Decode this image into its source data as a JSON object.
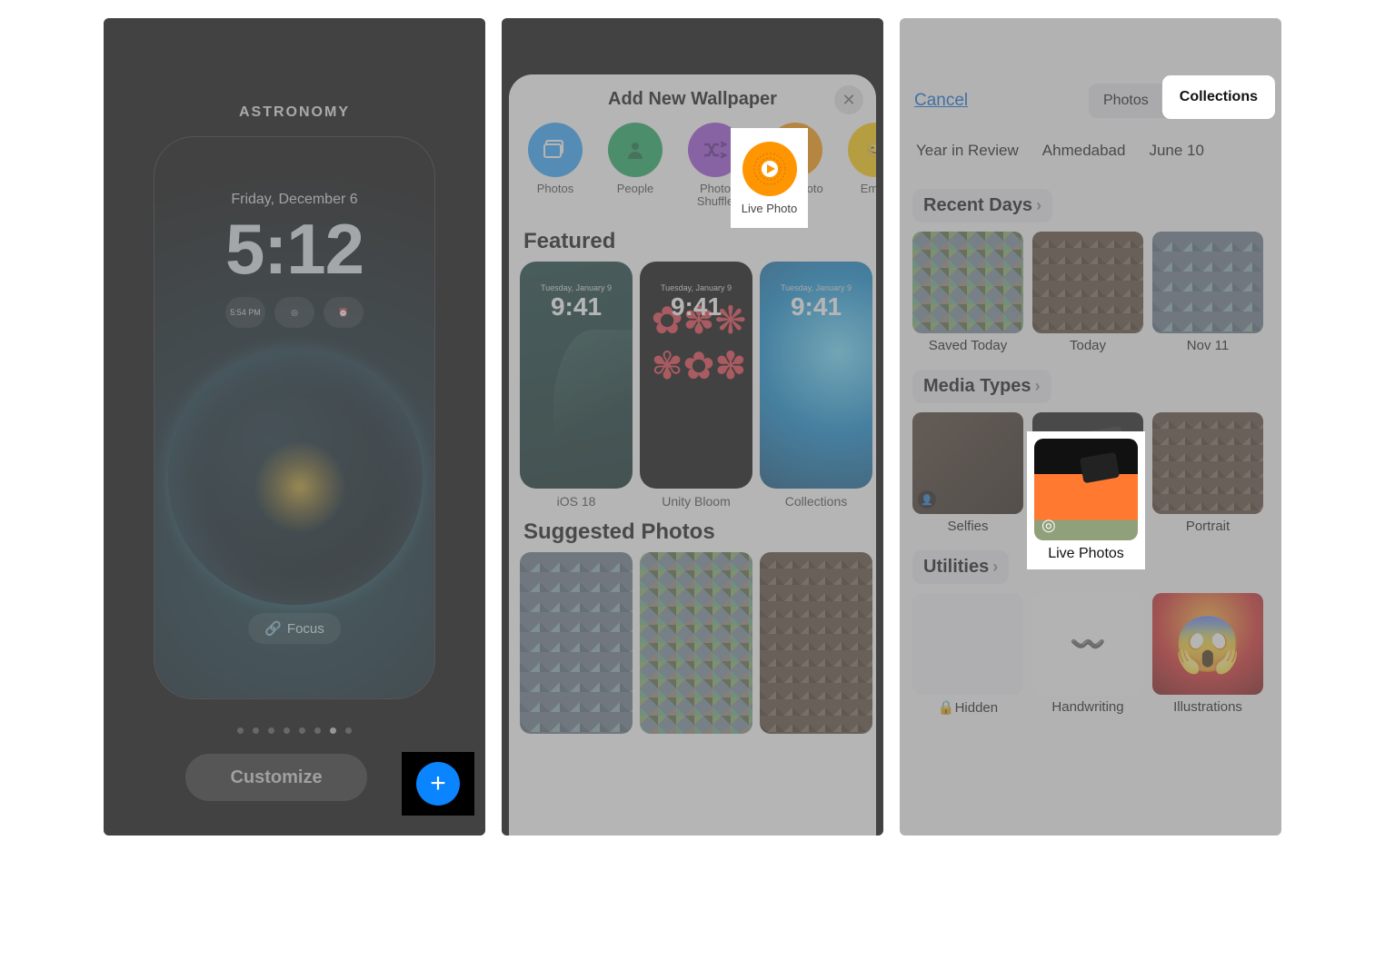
{
  "panel1": {
    "category": "ASTRONOMY",
    "date": "Friday, December 6",
    "time": "5:12",
    "widget_time_label": "5:54\nPM",
    "focus_label": "Focus",
    "customize_label": "Customize",
    "add_label": "+"
  },
  "panel2": {
    "title": "Add New Wallpaper",
    "close_label": "✕",
    "categories": {
      "photos": "Photos",
      "people": "People",
      "shuffle": "Photo\nShuffle",
      "live": "Live Photo",
      "emoji": "Emoji"
    },
    "featured_heading": "Featured",
    "featured_tinydate": "Tuesday, January 9",
    "featured_tinytime": "9:41",
    "featured": {
      "ios": "iOS 18",
      "unity": "Unity Bloom",
      "collections": "Collections"
    },
    "suggested_heading": "Suggested Photos"
  },
  "panel3": {
    "cancel": "Cancel",
    "seg_photos": "Photos",
    "seg_collections": "Collections",
    "chips": {
      "year": "Year in Review",
      "city": "Ahmedabad",
      "date": "June 10"
    },
    "recent_heading": "Recent Days",
    "recent": {
      "saved": "Saved Today",
      "today": "Today",
      "nov": "Nov 11"
    },
    "media_heading": "Media Types",
    "media": {
      "selfies": "Selfies",
      "live": "Live Photos",
      "portrait": "Portrait"
    },
    "util_heading": "Utilities",
    "util": {
      "hidden": "Hidden",
      "handwriting": "Handwriting",
      "illustrations": "Illustrations"
    },
    "lock_symbol": "🔒"
  }
}
